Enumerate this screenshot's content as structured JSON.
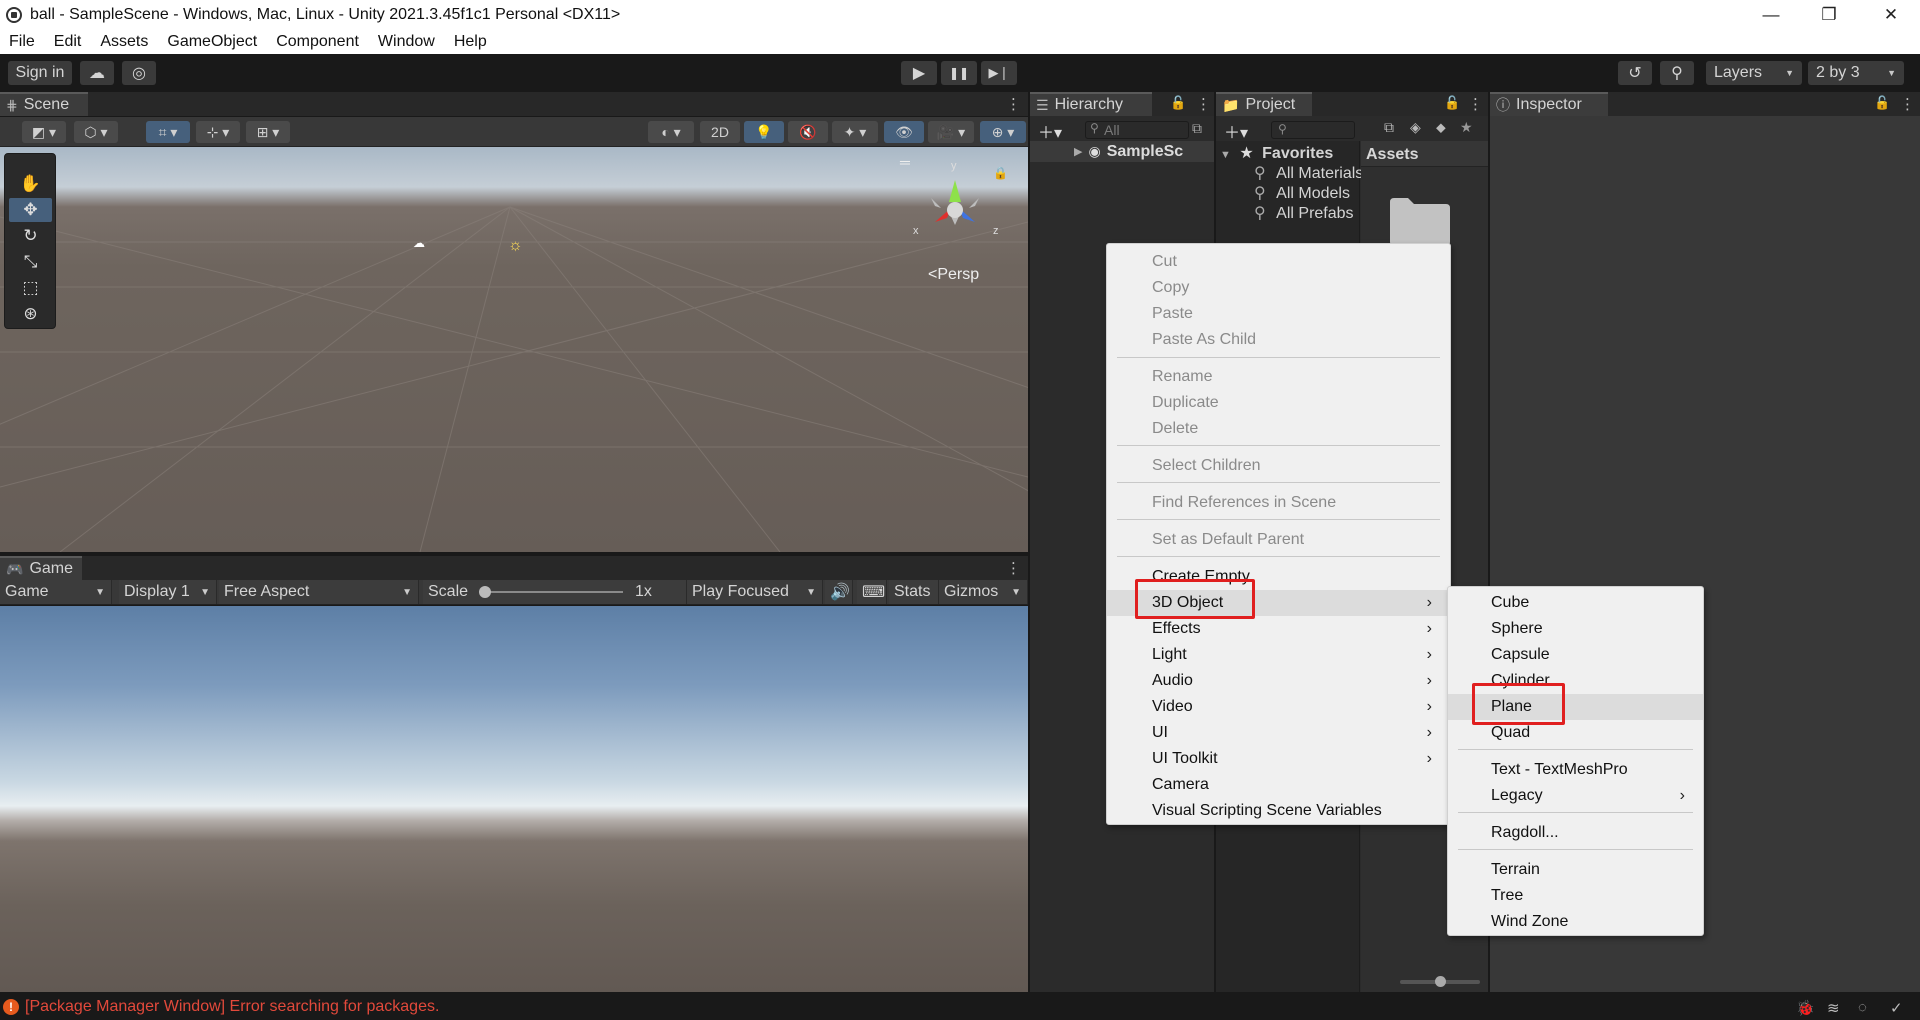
{
  "window": {
    "title": "ball - SampleScene - Windows, Mac, Linux - Unity 2021.3.45f1c1 Personal <DX11>",
    "controls": {
      "minimize": "—",
      "maximize": "❐",
      "close": "✕"
    }
  },
  "menubar": [
    "File",
    "Edit",
    "Assets",
    "GameObject",
    "Component",
    "Window",
    "Help"
  ],
  "toolbar": {
    "sign_in": "Sign in",
    "layers": "Layers",
    "layout": "2 by 3"
  },
  "scene": {
    "tab_label": "Scene",
    "toggle_2d": "2D",
    "gizmo_axes": {
      "x": "x",
      "y": "y",
      "z": "z"
    },
    "projection_label": "<Persp"
  },
  "game": {
    "tab_label": "Game",
    "view_select": "Game",
    "display": "Display 1",
    "aspect": "Free Aspect",
    "scale_label": "Scale",
    "scale_value": "1x",
    "play_mode": "Play Focused",
    "stats": "Stats",
    "gizmos": "Gizmos"
  },
  "hierarchy": {
    "tab_label": "Hierarchy",
    "search_placeholder": "All",
    "scene_row": "SampleSc"
  },
  "project": {
    "tab_label": "Project",
    "favorites": "Favorites",
    "favorite_items": [
      "All Materials",
      "All Models",
      "All Prefabs"
    ],
    "assets_header": "Assets"
  },
  "inspector": {
    "tab_label": "Inspector"
  },
  "status": {
    "error_message": "[Package Manager Window] Error searching for packages."
  },
  "context_menu": {
    "items": [
      {
        "label": "Cut",
        "disabled": true
      },
      {
        "label": "Copy",
        "disabled": true
      },
      {
        "label": "Paste",
        "disabled": true
      },
      {
        "label": "Paste As Child",
        "disabled": true
      },
      {
        "label": "Rename",
        "disabled": true
      },
      {
        "label": "Duplicate",
        "disabled": true
      },
      {
        "label": "Delete",
        "disabled": true
      },
      {
        "label": "Select Children",
        "disabled": true
      },
      {
        "label": "Find References in Scene",
        "disabled": true
      },
      {
        "label": "Set as Default Parent",
        "disabled": true
      },
      {
        "label": "Create Empty",
        "disabled": false
      },
      {
        "label": "3D Object",
        "disabled": false,
        "submenu": true,
        "highlighted": true
      },
      {
        "label": "Effects",
        "disabled": false,
        "submenu": true
      },
      {
        "label": "Light",
        "disabled": false,
        "submenu": true
      },
      {
        "label": "Audio",
        "disabled": false,
        "submenu": true
      },
      {
        "label": "Video",
        "disabled": false,
        "submenu": true
      },
      {
        "label": "UI",
        "disabled": false,
        "submenu": true
      },
      {
        "label": "UI Toolkit",
        "disabled": false,
        "submenu": true
      },
      {
        "label": "Camera",
        "disabled": false
      },
      {
        "label": "Visual Scripting Scene Variables",
        "disabled": false
      }
    ]
  },
  "submenu_3d_object": {
    "items": [
      {
        "label": "Cube"
      },
      {
        "label": "Sphere"
      },
      {
        "label": "Capsule"
      },
      {
        "label": "Cylinder"
      },
      {
        "label": "Plane",
        "highlighted": true
      },
      {
        "label": "Quad"
      },
      {
        "label": "Text - TextMeshPro"
      },
      {
        "label": "Legacy",
        "submenu": true
      },
      {
        "label": "Ragdoll..."
      },
      {
        "label": "Terrain"
      },
      {
        "label": "Tree"
      },
      {
        "label": "Wind Zone"
      }
    ]
  },
  "colors": {
    "highlight": "#e01f1f",
    "accent": "#46607c",
    "error": "#e2493b"
  }
}
